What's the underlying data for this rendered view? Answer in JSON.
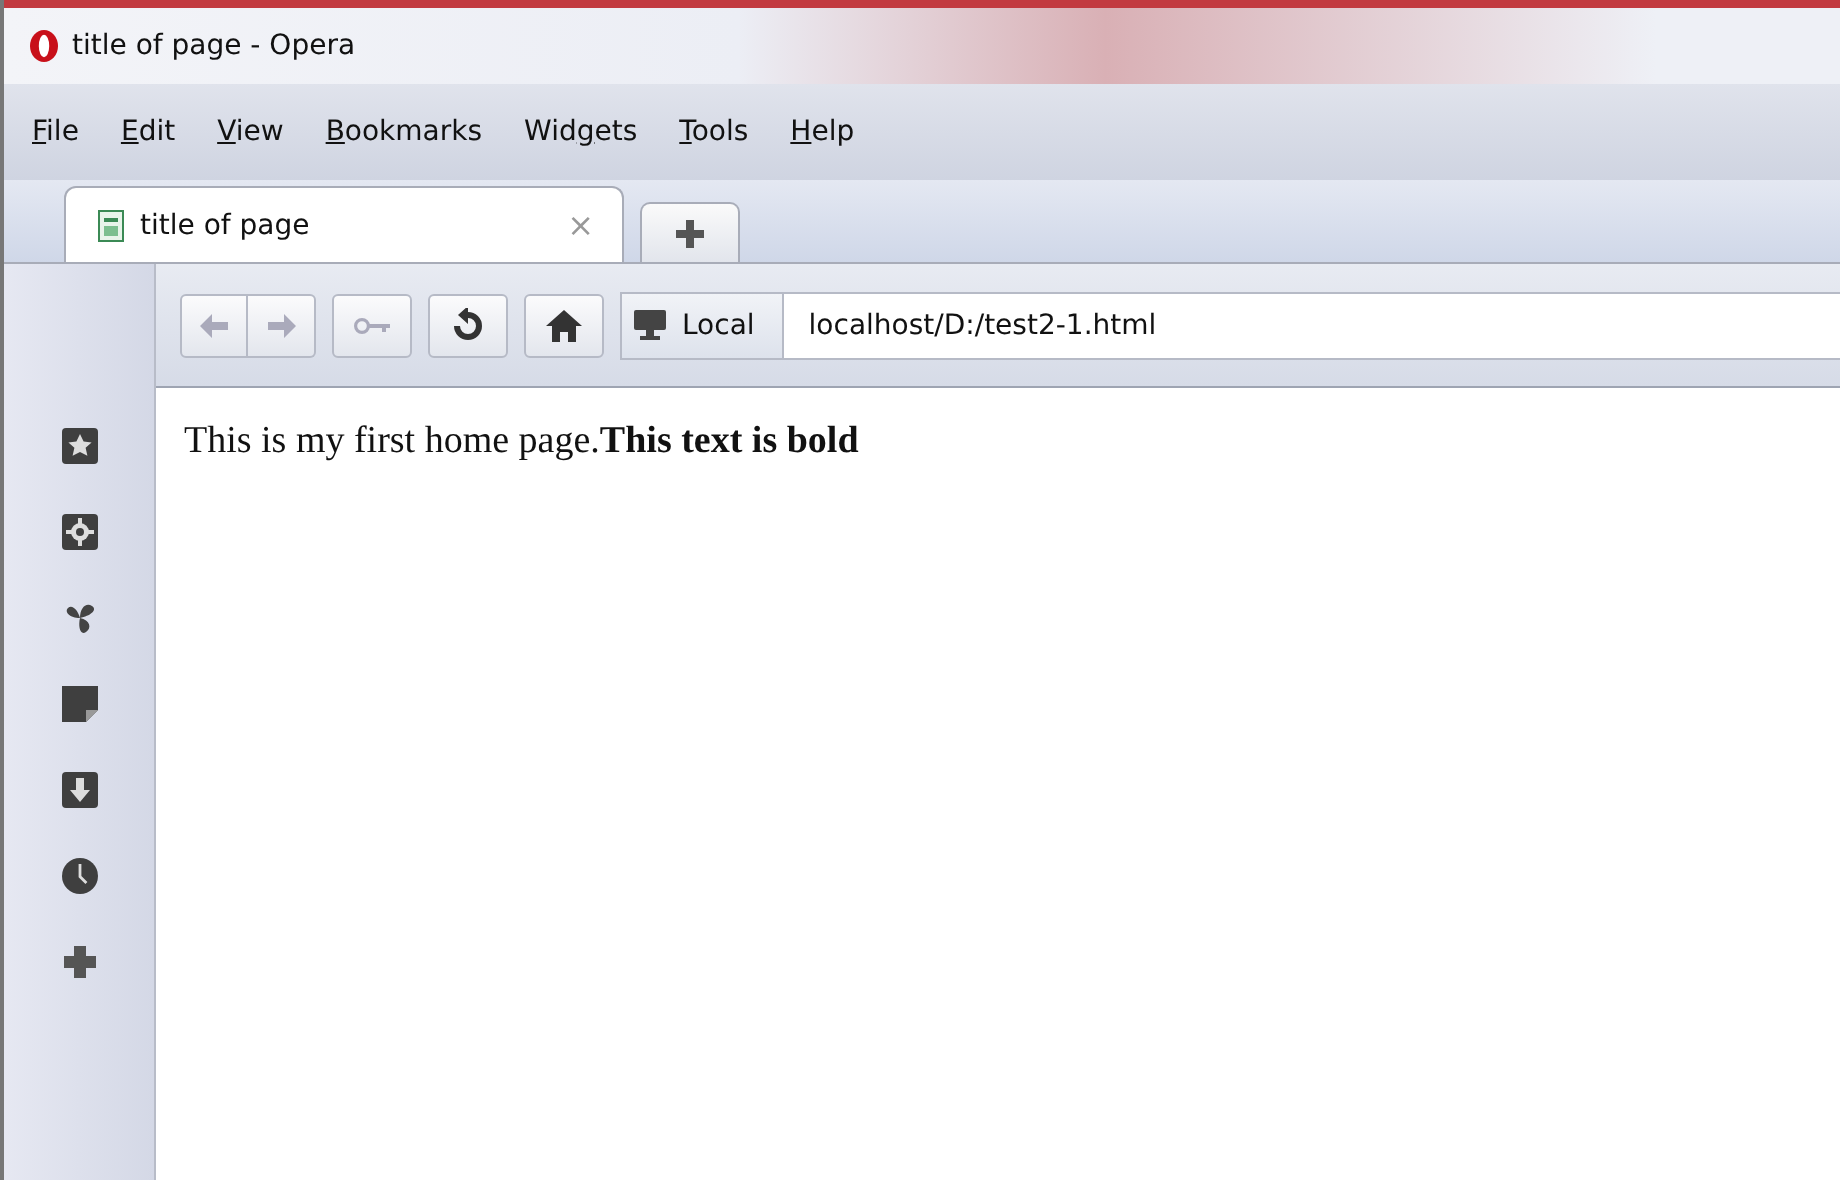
{
  "window": {
    "title": "title of page - Opera"
  },
  "menu": [
    {
      "key": "F",
      "after": "ile"
    },
    {
      "key": "E",
      "after": "dit"
    },
    {
      "key": "V",
      "after": "iew"
    },
    {
      "key": "B",
      "after": "ookmarks"
    },
    {
      "before": "Wid",
      "key": "g",
      "after": "ets"
    },
    {
      "key": "T",
      "after": "ools"
    },
    {
      "key": "H",
      "after": "elp"
    }
  ],
  "tabs": [
    {
      "label": "title of page",
      "selected": true,
      "close": "×"
    }
  ],
  "address": {
    "badge": "Local",
    "value": "localhost/D:/test2-1.html"
  },
  "page": {
    "text": "This is my first home page.**This text is bold**"
  }
}
